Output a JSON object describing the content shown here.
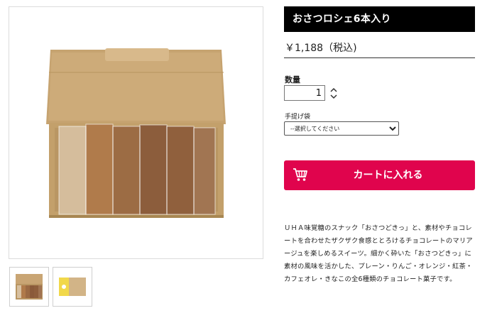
{
  "product": {
    "title": "おさつロシェ6本入り",
    "price": "￥1,188（税込)",
    "quantity_label": "数量",
    "quantity_value": "1",
    "bag_label": "手提げ袋",
    "bag_selected": "--選択してください",
    "cart_button_label": "カートに入れる",
    "description": "ＵＨＡ味覚糖のスナック「おさつどきっ」と、素材やチョコレートを合わせたザクザク食感ととろけるチョコレートのマリアージュを楽しめるスイーツ。細かく砕いた「おさつどきっ」に素材の風味を活かした、プレーン・りんご・オレンジ・紅茶・カフェオレ・きなこの全6種類のチョコレート菓子です。"
  },
  "colors": {
    "title_bar": "#000000",
    "cart_button": "#e0044d",
    "box_kraft": "#c9a574"
  },
  "icons": {
    "cart": "cart-icon",
    "quantity_up": "chevron-up-icon",
    "quantity_down": "chevron-down-icon"
  }
}
